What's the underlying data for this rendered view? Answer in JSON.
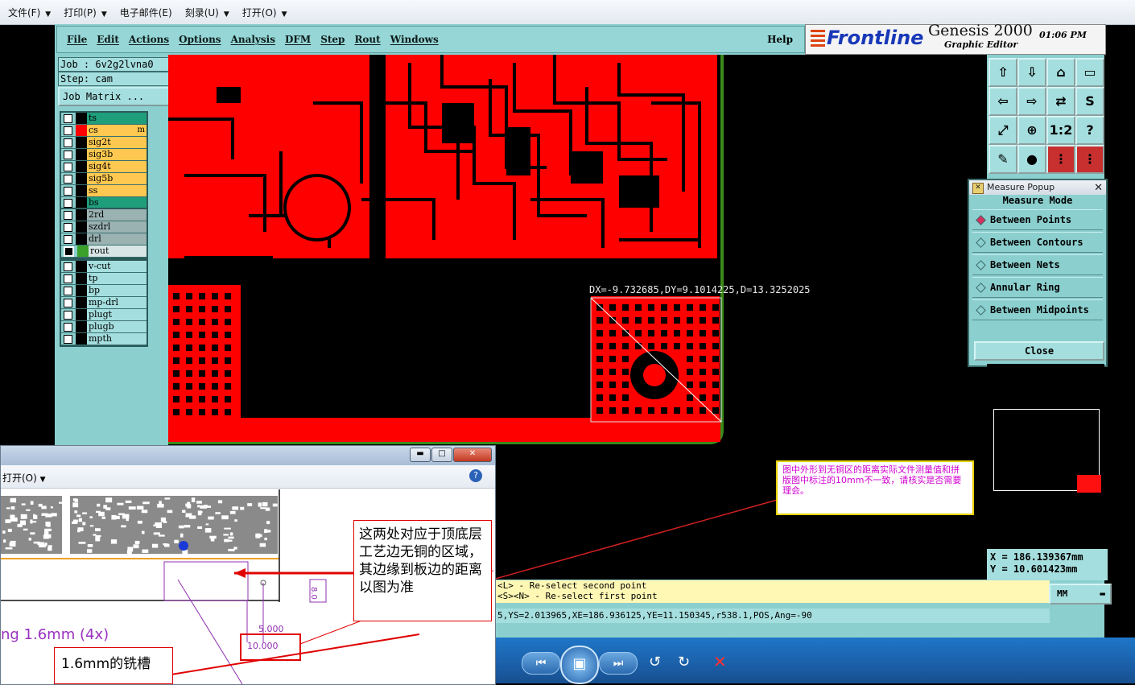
{
  "toolbar": {
    "items": [
      "文件(F)",
      "打印(P)",
      "电子邮件(E)",
      "刻录(U)",
      "打开(O)"
    ]
  },
  "genesis": {
    "menu": [
      "File",
      "Edit",
      "Actions",
      "Options",
      "Analysis",
      "DFM",
      "Step",
      "Rout",
      "Windows"
    ],
    "help": "Help",
    "brand": "Frontline",
    "product": "Genesis 2000",
    "subtitle": "Graphic Editor",
    "time": "01:06 PM",
    "job": "Job : 6v2g2lvna0",
    "step": "Step: cam",
    "job_matrix": "Job Matrix ...",
    "colors": {
      "teal": "#8ccfcf",
      "board": "#ff0000",
      "profile": "#3a8a1a",
      "note_text": "#d000d0"
    }
  },
  "layers": {
    "group1": [
      {
        "name": "ts",
        "color": "#1f9e7c",
        "swatch": "#000000"
      },
      {
        "name": "cs",
        "color": "#ffc850",
        "swatch": "#ff0000",
        "mark": "m"
      },
      {
        "name": "sig2t",
        "color": "#ffc850",
        "swatch": "#000000"
      },
      {
        "name": "sig3b",
        "color": "#ffc850",
        "swatch": "#000000"
      },
      {
        "name": "sig4t",
        "color": "#ffc850",
        "swatch": "#000000"
      },
      {
        "name": "sig5b",
        "color": "#ffc850",
        "swatch": "#000000"
      },
      {
        "name": "ss",
        "color": "#ffc850",
        "swatch": "#000000"
      },
      {
        "name": "bs",
        "color": "#1f9e7c",
        "swatch": "#000000"
      }
    ],
    "group2": [
      {
        "name": "2rd",
        "color": "#9ab2b2",
        "swatch": "#000000"
      },
      {
        "name": "szdrl",
        "color": "#9ab2b2",
        "swatch": "#000000"
      },
      {
        "name": "drl",
        "color": "#9ab2b2",
        "swatch": "#000000"
      },
      {
        "name": "rout",
        "color": "#d8e6e6",
        "swatch": "#3aa02a",
        "active": true
      }
    ],
    "group3": [
      {
        "name": "v-cut",
        "color": "#a5dede",
        "swatch": "#000000"
      },
      {
        "name": "tp",
        "color": "#a5dede",
        "swatch": "#000000"
      },
      {
        "name": "bp",
        "color": "#a5dede",
        "swatch": "#000000"
      },
      {
        "name": "mp-drl",
        "color": "#a5dede",
        "swatch": "#000000"
      },
      {
        "name": "plugt",
        "color": "#a5dede",
        "swatch": "#000000"
      },
      {
        "name": "plugb",
        "color": "#a5dede",
        "swatch": "#000000"
      },
      {
        "name": "mpth",
        "color": "#a5dede",
        "swatch": "#000000"
      }
    ]
  },
  "canvas": {
    "measure_readout": "DX=-9.732685,DY=9.1014225,D=13.3252025"
  },
  "measure_popup": {
    "title": "Measure Popup",
    "mode_label": "Measure Mode",
    "options": [
      "Between Points",
      "Between Contours",
      "Between Nets",
      "Annular Ring",
      "Between Midpoints"
    ],
    "selected": "Between Points",
    "close": "Close"
  },
  "note": {
    "text": "图中外形到无铜区的距离实际文件测量值和拼版图中标注的10mm不一致，请核实是否需要理会。"
  },
  "status": {
    "x": "X  =  186.139367mm",
    "y": "Y  =  10.601423mm",
    "prompt1": "<L> - Re-select second point",
    "prompt2": "<S><N> - Re-select first point",
    "coords": "5,YS=2.013965,XE=186.936125,YE=11.150345,r538.1,POS,Ang=-90",
    "units": "MM"
  },
  "overlay": {
    "toolbar_label": "打开(O)",
    "callout": "这两处对应于顶底层工艺边无铜的区域，其边缘到板边的距离以图为准",
    "spacing_label": "ng 1.6mm (4x)",
    "dim1": "5.000",
    "dim2": "10.000",
    "dim_side": "8.0",
    "slot_label": "1.6mm的铣槽"
  }
}
